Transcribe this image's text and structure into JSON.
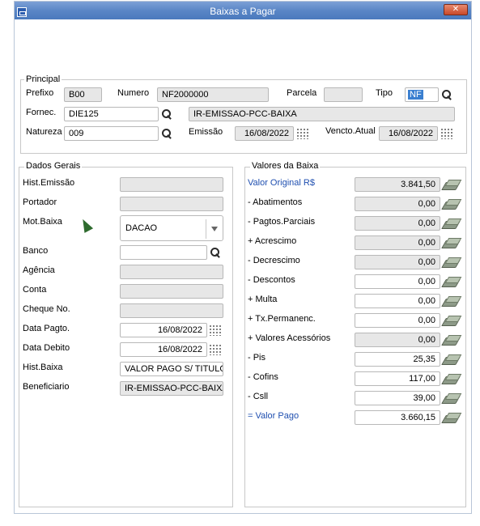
{
  "window": {
    "title": "Baixas a Pagar",
    "close_label": "✕"
  },
  "principal": {
    "legend": "Principal",
    "prefixo_label": "Prefixo",
    "prefixo": "B00",
    "numero_label": "Numero",
    "numero": "NF2000000",
    "parcela_label": "Parcela",
    "parcela": "",
    "tipo_label": "Tipo",
    "tipo": "NF",
    "fornec_label": "Fornec.",
    "fornec": "DIE125",
    "fornec_nome": "IR-EMISSAO-PCC-BAIXA",
    "natureza_label": "Natureza",
    "natureza": "009",
    "emissao_label": "Emissão",
    "emissao": "16/08/2022",
    "vencto_label": "Vencto.Atual",
    "vencto": "16/08/2022"
  },
  "dados_gerais": {
    "legend": "Dados Gerais",
    "hist_emissao_label": "Hist.Emissão",
    "hist_emissao": "",
    "portador_label": "Portador",
    "portador": "",
    "mot_baixa_label": "Mot.Baixa",
    "mot_baixa": "DACAO",
    "banco_label": "Banco",
    "banco": "",
    "agencia_label": "Agência",
    "agencia": "",
    "conta_label": "Conta",
    "conta": "",
    "cheque_label": "Cheque No.",
    "cheque": "",
    "data_pagto_label": "Data Pagto.",
    "data_pagto": "16/08/2022",
    "data_debito_label": "Data Debito",
    "data_debito": "16/08/2022",
    "hist_baixa_label": "Hist.Baixa",
    "hist_baixa": "VALOR PAGO S/ TITULO",
    "beneficiario_label": "Beneficiario",
    "beneficiario": "IR-EMISSAO-PCC-BAIXA"
  },
  "valores": {
    "legend": "Valores da Baixa",
    "rows": [
      {
        "label": "Valor Original R$",
        "value": "3.841,50"
      },
      {
        "label": "- Abatimentos",
        "value": "0,00"
      },
      {
        "label": "- Pagtos.Parciais",
        "value": "0,00"
      },
      {
        "label": "+ Acrescimo",
        "value": "0,00"
      },
      {
        "label": "- Decrescimo",
        "value": "0,00"
      },
      {
        "label": "- Descontos",
        "value": "0,00"
      },
      {
        "label": "+ Multa",
        "value": "0,00"
      },
      {
        "label": "+ Tx.Permanenc.",
        "value": "0,00"
      },
      {
        "label": "+ Valores Acessórios",
        "value": "0,00"
      },
      {
        "label": "- Pis",
        "value": "25,35"
      },
      {
        "label": "- Cofins",
        "value": "117,00"
      },
      {
        "label": "- Csll",
        "value": "39,00"
      },
      {
        "label": "= Valor Pago",
        "value": "3.660,15"
      }
    ]
  },
  "colors": {
    "title_bar": "#5a86c6",
    "blue_label": "#1f4fb0",
    "close_button": "#c8492a"
  }
}
